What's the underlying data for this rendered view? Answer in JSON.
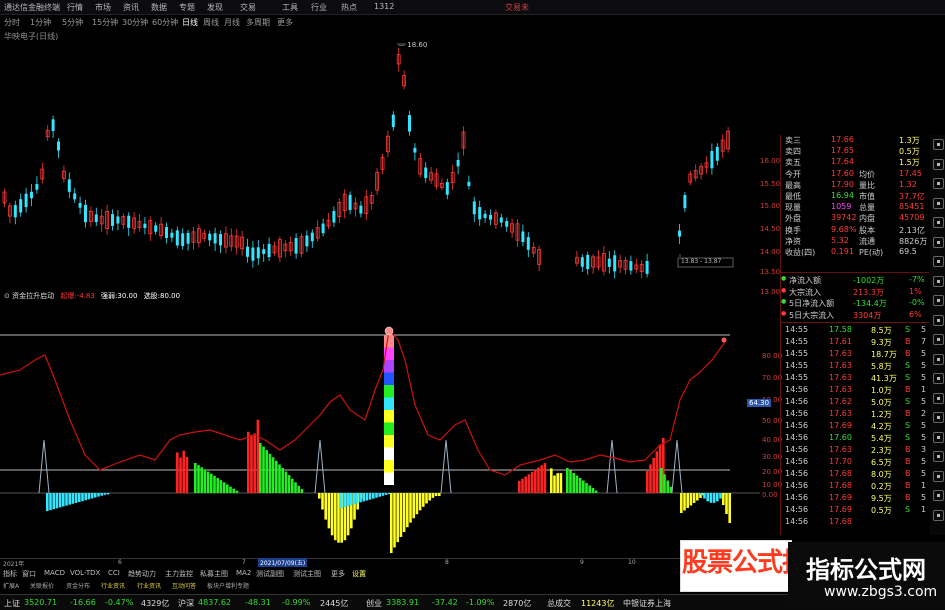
{
  "topbar": {
    "app_title": "通达信金融终端",
    "menus": [
      "行情",
      "市场",
      "资讯",
      "数据",
      "专题",
      "发现",
      "交易",
      "工具",
      "行业",
      "热点",
      "1312"
    ],
    "right": "交易未"
  },
  "periods": [
    "分时",
    "1分钟",
    "5分钟",
    "15分钟",
    "30分钟",
    "60分钟",
    "日线",
    "周线",
    "月线",
    "多周期",
    "更多"
  ],
  "active_period": "日线",
  "stock_name": "华映电子(日线)",
  "price_high_label": "18.60",
  "range_box_label": "13.83 - 13.87",
  "right_panel": {
    "quote": [
      {
        "label": "卖三",
        "value": "17.66",
        "aux": "1.3万"
      },
      {
        "label": "卖四",
        "value": "17.65",
        "aux": "0.5万"
      },
      {
        "label": "卖五",
        "value": "17.64",
        "aux": "1.5万"
      },
      {
        "label": "今开",
        "value": "17.60",
        "label2": "均价",
        "value2": "17.45"
      },
      {
        "label": "最高",
        "value": "17.90",
        "label2": "量比",
        "value2": "1.32"
      },
      {
        "label": "最低",
        "value": "16.94",
        "label2": "市值",
        "value2": "37.7亿"
      },
      {
        "label": "现量",
        "value": "1059",
        "label2": "总量",
        "value2": "85451"
      },
      {
        "label": "外盘",
        "value": "39742",
        "label2": "内盘",
        "value2": "45709"
      },
      {
        "label": "换手",
        "value": "9.68%",
        "label2": "股本",
        "value2": "2.13亿"
      },
      {
        "label": "净资",
        "value": "5.32",
        "label2": "流通",
        "value2": "8826万"
      },
      {
        "label": "收益(四)",
        "value": "0.191",
        "label2": "PE(动)",
        "value2": "69.5"
      }
    ],
    "yaxis": [
      "16.00",
      "15.50",
      "15.00",
      "14.50",
      "14.00",
      "13.50",
      "13.00"
    ],
    "flow": [
      {
        "label": "净流入额",
        "value": "-1002万",
        "pct": "-7%"
      },
      {
        "label": "大宗流入",
        "value": "213.3万",
        "pct": "1%"
      },
      {
        "label": "5日净流入额",
        "value": "-134.4万",
        "pct": "-0%"
      },
      {
        "label": "5日大宗流入",
        "value": "3304万",
        "pct": "6%"
      }
    ],
    "ticks": [
      {
        "t": "14:55",
        "p": "17.58",
        "v": "8.5万",
        "s": "S",
        "n": "5"
      },
      {
        "t": "14:55",
        "p": "17.61",
        "v": "9.3万",
        "s": "B",
        "n": "7"
      },
      {
        "t": "14:55",
        "p": "17.63",
        "v": "18.7万",
        "s": "B",
        "n": "5"
      },
      {
        "t": "14:55",
        "p": "17.63",
        "v": "5.8万",
        "s": "S",
        "n": "5"
      },
      {
        "t": "14:55",
        "p": "17.63",
        "v": "41.3万",
        "s": "S",
        "n": "5"
      },
      {
        "t": "14:56",
        "p": "17.63",
        "v": "1.0万",
        "s": "B",
        "n": "1"
      },
      {
        "t": "14:56",
        "p": "17.62",
        "v": "5.0万",
        "s": "S",
        "n": "5"
      },
      {
        "t": "14:56",
        "p": "17.63",
        "v": "1.2万",
        "s": "B",
        "n": "2"
      },
      {
        "t": "14:56",
        "p": "17.69",
        "v": "4.2万",
        "s": "S",
        "n": "5"
      },
      {
        "t": "14:56",
        "p": "17.60",
        "v": "5.4万",
        "s": "S",
        "n": "5"
      },
      {
        "t": "14:56",
        "p": "17.63",
        "v": "2.3万",
        "s": "B",
        "n": "3"
      },
      {
        "t": "14:56",
        "p": "17.70",
        "v": "6.5万",
        "s": "B",
        "n": "5"
      },
      {
        "t": "14:56",
        "p": "17.68",
        "v": "8.0万",
        "s": "B",
        "n": "5"
      },
      {
        "t": "14:56",
        "p": "17.68",
        "v": "0.2万",
        "s": "B",
        "n": "1"
      },
      {
        "t": "14:56",
        "p": "17.69",
        "v": "9.5万",
        "s": "B",
        "n": "5"
      },
      {
        "t": "14:56",
        "p": "17.69",
        "v": "0.5万",
        "s": "S",
        "n": "1"
      },
      {
        "t": "14:56",
        "p": "17.68",
        "v": "",
        "s": "",
        "n": ""
      }
    ]
  },
  "indicator": {
    "name": "资金拉升启动",
    "label_a": "起爆:",
    "value_a": "-4.83",
    "label_b": "强弱:",
    "value_b": "30.00",
    "label_c": "选股:",
    "value_c": "80.00",
    "marker": "64.30",
    "yaxis": [
      "80.00",
      "70.00",
      "60.00",
      "50.00",
      "40.00",
      "30.00",
      "20.00",
      "10.00",
      "0.00"
    ]
  },
  "dates": {
    "year": "2021年",
    "m1": "6",
    "m2": "7",
    "highlight": "2021/07/09(五)",
    "m3": "8",
    "m4": "9",
    "m5": "10",
    "m6": "11"
  },
  "tabs1": [
    "指标",
    "窗口",
    "MACD",
    "VOL-TDX",
    "CCI",
    "趋势动力",
    "主力监控",
    "私募主图",
    "MA2",
    "测试副图",
    "测试主图",
    "更多",
    "设置"
  ],
  "tabs2": [
    "扩展A",
    "关联报价",
    "资金分布",
    "行业资讯",
    "行业资讯",
    "互动问答",
    "板块户增利专题"
  ],
  "status": {
    "sh_label": "上证",
    "sh_val": "3520.71",
    "sh_chg": "-16.66",
    "sh_pct": "-0.47%",
    "sh_amt": "4329亿",
    "sz_label": "沪深",
    "sz_val": "4837.62",
    "sz_chg": "-48.31",
    "sz_pct": "-0.99%",
    "sz_amt": "2445亿",
    "cy_label": "创业",
    "cy_val": "3383.91",
    "cy_chg": "-37.42",
    "cy_pct": "-1.09%",
    "cy_amt": "2870亿",
    "total": "总成交",
    "total_val": "11243亿",
    "broker": "中银证券上海"
  },
  "watermark": {
    "left_text": "股票公式指标网",
    "right_text": "指标公式网",
    "url": "www.zbgs3.com"
  },
  "colors": {
    "up": "#ff3333",
    "down": "#33ffff",
    "text_yellow": "#ffff00",
    "grid": "#aa2222"
  }
}
